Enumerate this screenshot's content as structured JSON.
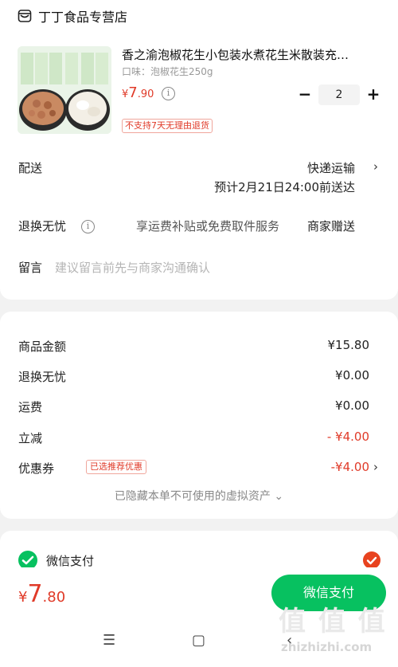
{
  "shop": {
    "name": "丁丁食品专营店"
  },
  "product": {
    "title": "香之渝泡椒花生小包装水煮花生米散装充…",
    "spec": "口味：泡椒花生250g",
    "price_symbol": "¥",
    "price_int": "7",
    "price_dec": ".90",
    "no_return_tag": "不支持7天无理由退货",
    "quantity": "2",
    "minus": "−",
    "plus": "+",
    "info": "i"
  },
  "delivery": {
    "label": "配送",
    "method": "快递运输",
    "estimate": "预计2月21日24:00前送达",
    "chevron": "›"
  },
  "returns": {
    "label": "退换无忧",
    "info": "i",
    "desc": "享运费补贴或免费取件服务",
    "gift": "商家赠送"
  },
  "message": {
    "label": "留言",
    "placeholder": "建议留言前先与商家沟通确认"
  },
  "summary": {
    "rows": [
      {
        "label": "商品金额",
        "value": "¥15.80"
      },
      {
        "label": "退换无忧",
        "value": "¥0.00"
      },
      {
        "label": "运费",
        "value": "¥0.00"
      },
      {
        "label": "立减",
        "value": "- ¥4.00"
      },
      {
        "label": "优惠券",
        "value": "-¥4.00"
      }
    ],
    "coupon_badge": "已选推荐优惠",
    "coupon_chevron": "›",
    "hidden_assets": "已隐藏本单不可使用的虚拟资产 ⌄"
  },
  "payment": {
    "method": "微信支付"
  },
  "footer": {
    "total_symbol": "¥",
    "total_int": "7",
    "total_dec": ".80",
    "pay_button": "微信支付",
    "nav_menu": "☰",
    "nav_home": "▢",
    "nav_back": "‹"
  },
  "watermark": {
    "text": "值 值 值",
    "url": "zhizhizhi.com"
  },
  "colors": {
    "price_red": "#e03a28",
    "wechat_green": "#07c160",
    "check_orange": "#e8431f",
    "page_bg": "#f2f2f2"
  }
}
